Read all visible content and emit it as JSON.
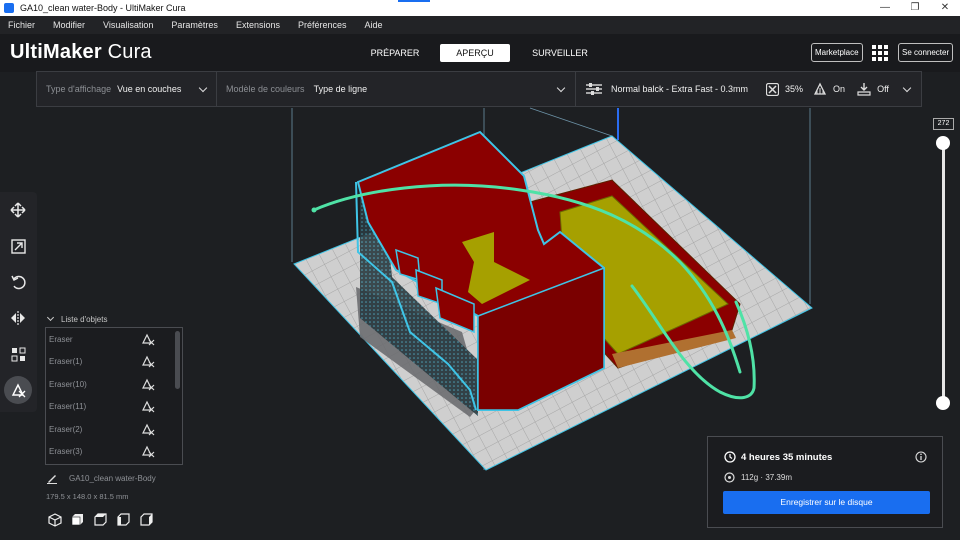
{
  "window": {
    "title": "GA10_clean water-Body - UltiMaker Cura",
    "controls": [
      "—",
      "❐",
      "✕"
    ]
  },
  "menu": [
    "Fichier",
    "Modifier",
    "Visualisation",
    "Paramètres",
    "Extensions",
    "Préférences",
    "Aide"
  ],
  "header": {
    "logo_bold": "UltiMaker",
    "logo_light": "Cura",
    "tabs": [
      {
        "label": "PRÉPARER",
        "active": false
      },
      {
        "label": "APERÇU",
        "active": true
      },
      {
        "label": "SURVEILLER",
        "active": false
      }
    ],
    "marketplace": "Marketplace",
    "connect": "Se connecter"
  },
  "settings_bar": {
    "view_type_label": "Type d'affichage",
    "view_type_value": "Vue en couches",
    "color_scheme_label": "Modèle de couleurs",
    "color_scheme_value": "Type de ligne",
    "profile": "Normal balck - Extra Fast - 0.3mm",
    "infill": "35%",
    "support": "On",
    "adhesion": "Off"
  },
  "toolbar": {
    "tools": [
      "move-icon",
      "scale-icon",
      "rotate-icon",
      "mirror-icon",
      "per-model-settings-icon",
      "support-blocker-icon"
    ]
  },
  "object_list": {
    "header": "Liste d'objets",
    "items": [
      "Eraser",
      "Eraser(1)",
      "Eraser(10)",
      "Eraser(11)",
      "Eraser(2)",
      "Eraser(3)"
    ]
  },
  "model": {
    "name": "GA10_clean water-Body",
    "dimensions": "179.5 x 148.0 x 81.5 mm"
  },
  "layer_slider": {
    "current_layer": "272"
  },
  "print_info": {
    "time": "4 heures 35 minutes",
    "material": "112g · 37.39m",
    "save_button": "Enregistrer sur le disque"
  },
  "colors": {
    "accent": "#196ef0",
    "wall_red": "#8b0000",
    "infill_yellow": "#a6a000",
    "outline_cyan": "#3fc4e6",
    "travel_green": "#4fe2a6",
    "build_plate": "#c8c8c8"
  }
}
